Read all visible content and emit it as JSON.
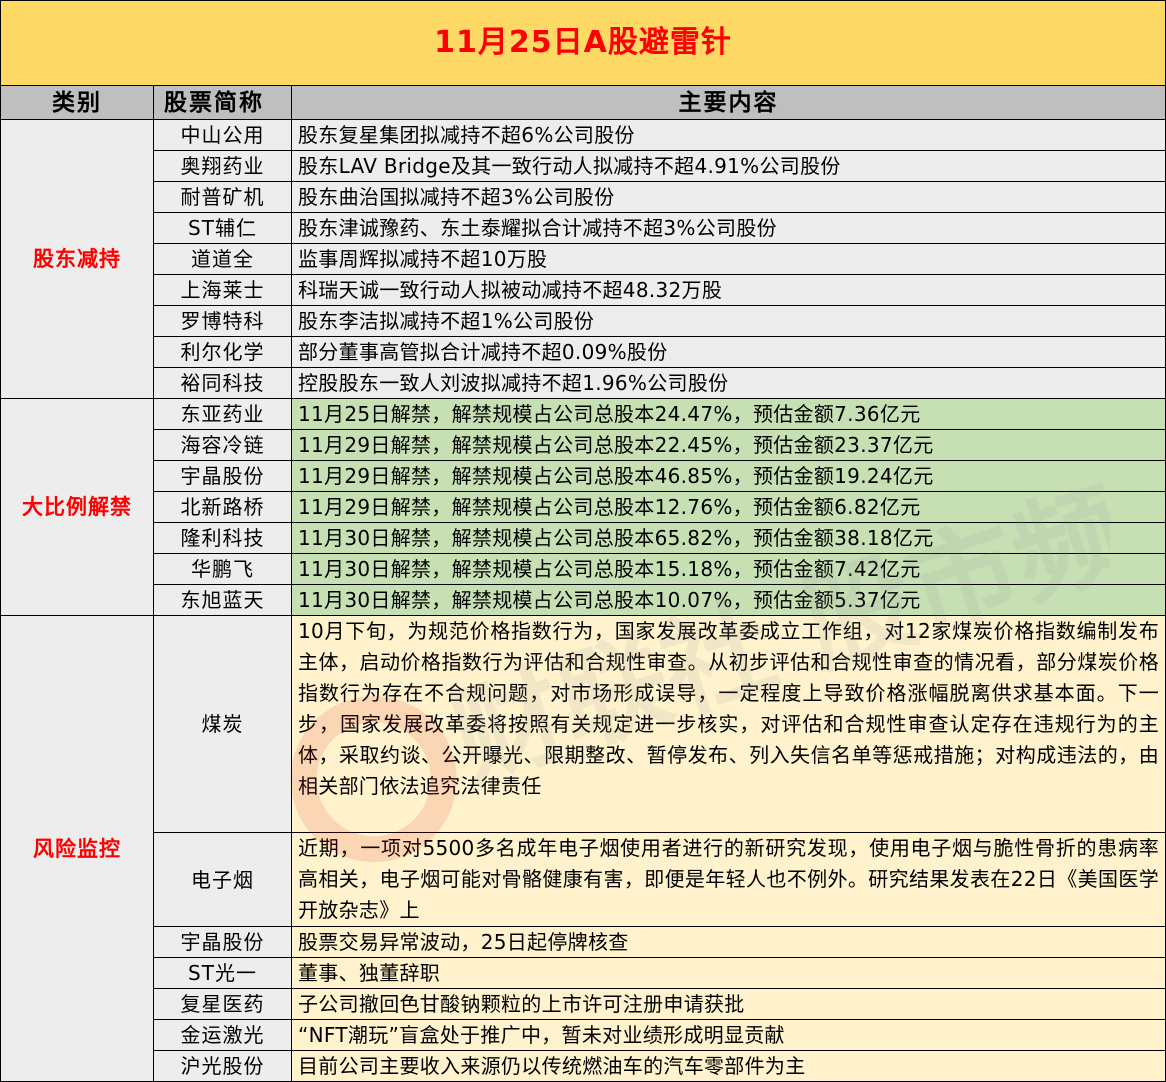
{
  "title": "11月25日A股避雷针",
  "headers": {
    "category": "类别",
    "stock": "股票简称",
    "content": "主要内容"
  },
  "watermark_text": "财联社 股市频道",
  "sections": [
    {
      "category": "股东减持",
      "color": "#ededed",
      "rows": [
        {
          "name": "中山公用",
          "content": "股东复星集团拟减持不超6%公司股份"
        },
        {
          "name": "奥翔药业",
          "content": "股东LAV Bridge及其一致行动人拟减持不超4.91%公司股份"
        },
        {
          "name": "耐普矿机",
          "content": "股东曲治国拟减持不超3%公司股份"
        },
        {
          "name": "ST辅仁",
          "content": "股东津诚豫药、东土泰耀拟合计减持不超3%公司股份"
        },
        {
          "name": "道道全",
          "content": "监事周辉拟减持不超10万股"
        },
        {
          "name": "上海莱士",
          "content": "科瑞天诚一致行动人拟被动减持不超48.32万股"
        },
        {
          "name": "罗博特科",
          "content": "股东李洁拟减持不超1%公司股份"
        },
        {
          "name": "利尔化学",
          "content": "部分董事高管拟合计减持不超0.09%股份"
        },
        {
          "name": "裕同科技",
          "content": "控股股东一致人刘波拟减持不超1.96%公司股份"
        }
      ]
    },
    {
      "category": "大比例解禁",
      "color": "#c6e0b4",
      "rows": [
        {
          "name": "东亚药业",
          "content": "11月25日解禁，解禁规模占公司总股本24.47%，预估金额7.36亿元"
        },
        {
          "name": "海容冷链",
          "content": "11月29日解禁，解禁规模占公司总股本22.45%，预估金额23.37亿元"
        },
        {
          "name": "宇晶股份",
          "content": "11月29日解禁，解禁规模占公司总股本46.85%，预估金额19.24亿元"
        },
        {
          "name": "北新路桥",
          "content": "11月29日解禁，解禁规模占公司总股本12.76%，预估金额6.82亿元"
        },
        {
          "name": "隆利科技",
          "content": "11月30日解禁，解禁规模占公司总股本65.82%，预估金额38.18亿元"
        },
        {
          "name": "华鹏飞",
          "content": "11月30日解禁，解禁规模占公司总股本15.18%，预估金额7.42亿元"
        },
        {
          "name": "东旭蓝天",
          "content": "11月30日解禁，解禁规模占公司总股本10.07%，预估金额5.37亿元"
        }
      ]
    },
    {
      "category": "风险监控",
      "color": "#fff2cc",
      "rows": [
        {
          "name": "煤炭",
          "content": "10月下旬，为规范价格指数行为，国家发展改革委成立工作组，对12家煤炭价格指数编制发布主体，启动价格指数行为评估和合规性审查。从初步评估和合规性审查的情况看，部分煤炭价格指数行为存在不合规问题，对市场形成误导，一定程度上导致价格涨幅脱离供求基本面。下一步，国家发展改革委将按照有关规定进一步核实，对评估和合规性审查认定存在违规行为的主体，采取约谈、公开曝光、限期整改、暂停发布、列入失信名单等惩戒措施；对构成违法的，由相关部门依法追究法律责任"
        },
        {
          "name": "电子烟",
          "content": "近期，一项对5500多名成年电子烟使用者进行的新研究发现，使用电子烟与脆性骨折的患病率高相关，电子烟可能对骨骼健康有害，即便是年轻人也不例外。研究结果发表在22日《美国医学开放杂志》上"
        },
        {
          "name": "宇晶股份",
          "content": "股票交易异常波动，25日起停牌核查"
        },
        {
          "name": "ST光一",
          "content": "董事、独董辞职"
        },
        {
          "name": "复星医药",
          "content": "子公司撤回色甘酸钠颗粒的上市许可注册申请获批"
        },
        {
          "name": "金运激光",
          "content": "“NFT潮玩”盲盒处于推广中，暂未对业绩形成明显贡献"
        },
        {
          "name": "沪光股份",
          "content": "目前公司主要收入来源仍以传统燃油车的汽车零部件为主"
        }
      ]
    }
  ]
}
